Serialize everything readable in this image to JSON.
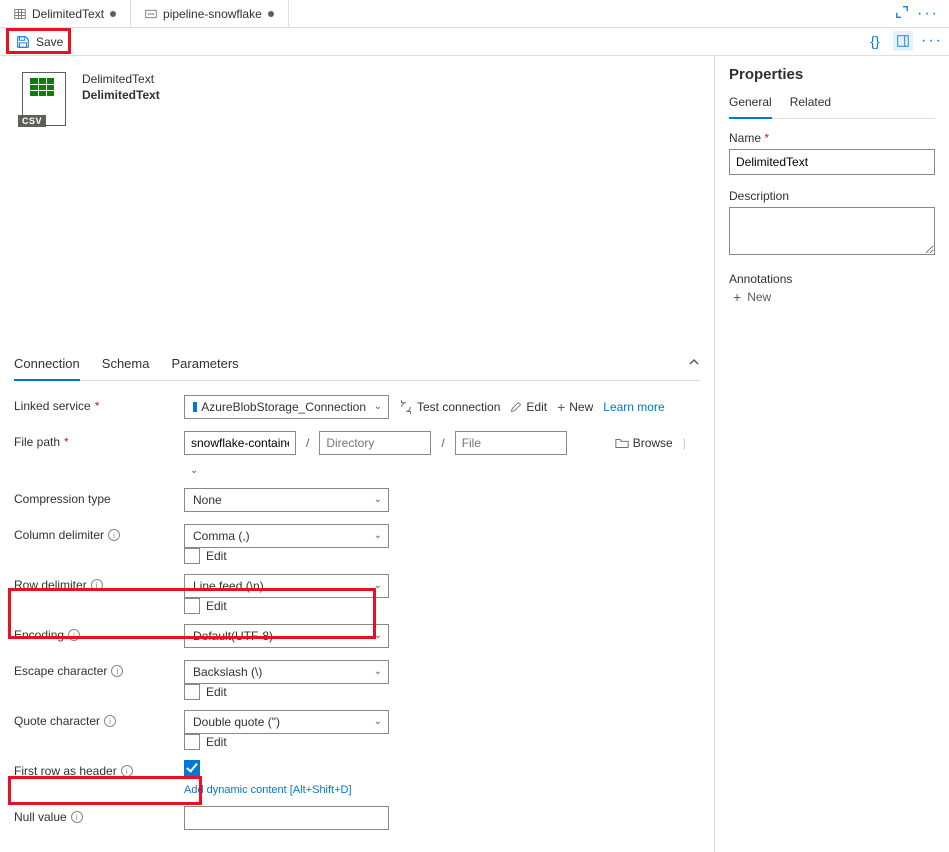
{
  "tabs": [
    {
      "label": "DelimitedText",
      "modified": true
    },
    {
      "label": "pipeline-snowflake",
      "modified": true
    }
  ],
  "toolbar": {
    "save_label": "Save"
  },
  "dataset": {
    "type_label": "DelimitedText",
    "name": "DelimitedText"
  },
  "section_tabs": {
    "connection": "Connection",
    "schema": "Schema",
    "parameters": "Parameters"
  },
  "form": {
    "linked_service_label": "Linked service",
    "linked_service_value": "AzureBlobStorage_Connection",
    "test_connection": "Test connection",
    "edit": "Edit",
    "new": "New",
    "learn_more": "Learn more",
    "file_path_label": "File path",
    "fp_container": "snowflake-container",
    "fp_dir_placeholder": "Directory",
    "fp_file_placeholder": "File",
    "browse": "Browse",
    "compression_label": "Compression type",
    "compression_value": "None",
    "col_delim_label": "Column delimiter",
    "col_delim_value": "Comma (,)",
    "row_delim_label": "Row delimiter",
    "row_delim_value": "Line feed (\\n)",
    "encoding_label": "Encoding",
    "encoding_value": "Default(UTF-8)",
    "escape_label": "Escape character",
    "escape_value": "Backslash (\\)",
    "quote_label": "Quote character",
    "quote_value": "Double quote (\")",
    "first_row_label": "First row as header",
    "dyn_content": "Add dynamic content [Alt+Shift+D]",
    "null_label": "Null value",
    "edit_cb": "Edit"
  },
  "properties": {
    "panel_title": "Properties",
    "tabs": {
      "general": "General",
      "related": "Related"
    },
    "name_label": "Name",
    "name_value": "DelimitedText",
    "desc_label": "Description",
    "ann_label": "Annotations",
    "new": "New"
  }
}
